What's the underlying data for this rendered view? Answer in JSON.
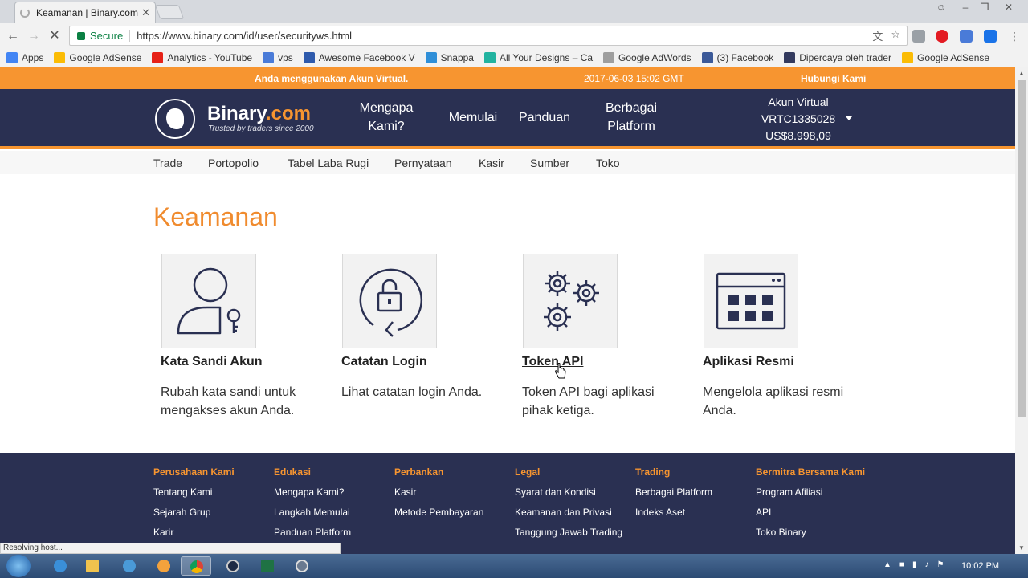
{
  "browser": {
    "tab_title": "Keamanan | Binary.com",
    "tab_close": "✕",
    "secure_label": "Secure",
    "url": "https://www.binary.com/id/user/securityws.html",
    "status_text": "Resolving host..."
  },
  "bookmarks": [
    {
      "label": "Apps",
      "color": "#4285f4"
    },
    {
      "label": "Google AdSense",
      "color": "#fbbc05"
    },
    {
      "label": "Analytics - YouTube",
      "color": "#e62117"
    },
    {
      "label": "vps",
      "color": "#4a7bd8"
    },
    {
      "label": "Awesome Facebook V",
      "color": "#2e5aac"
    },
    {
      "label": "Snappa",
      "color": "#2f8fd8"
    },
    {
      "label": "All Your Designs – Ca",
      "color": "#22b3a0"
    },
    {
      "label": "Google AdWords",
      "color": "#9e9e9e"
    },
    {
      "label": "(3) Facebook",
      "color": "#3b5998"
    },
    {
      "label": "Dipercaya oleh trader",
      "color": "#333a5e"
    },
    {
      "label": "Google AdSense",
      "color": "#fbbc05"
    }
  ],
  "topbar": {
    "virtual_notice": "Anda menggunakan Akun Virtual.",
    "datetime": "2017-06-03 15:02 GMT",
    "contact": "Hubungi Kami"
  },
  "mainnav": {
    "logo_name": "Binary",
    "logo_tld": ".com",
    "logo_tagline": "Trusted by traders since 2000",
    "why_line1": "Mengapa",
    "why_line2": "Kami?",
    "start": "Memulai",
    "guide": "Panduan",
    "platforms_line1": "Berbagai",
    "platforms_line2": "Platform",
    "account_label": "Akun Virtual",
    "account_id": "VRTC1335028",
    "account_balance": "US$8.998,09"
  },
  "subnav": [
    "Trade",
    "Portopolio",
    "Tabel Laba Rugi",
    "Pernyataan",
    "Kasir",
    "Sumber",
    "Toko"
  ],
  "page": {
    "heading": "Keamanan",
    "cards": [
      {
        "title": "Kata Sandi Akun",
        "desc": "Rubah kata sandi untuk mengakses akun Anda."
      },
      {
        "title": "Catatan Login",
        "desc": "Lihat catatan login Anda."
      },
      {
        "title": "Token API",
        "desc": "Token API bagi aplikasi pihak ketiga."
      },
      {
        "title": "Aplikasi Resmi",
        "desc": "Mengelola aplikasi resmi Anda."
      }
    ]
  },
  "footer": [
    {
      "heading": "Perusahaan Kami",
      "links": [
        "Tentang Kami",
        "Sejarah Grup",
        "Karir"
      ]
    },
    {
      "heading": "Edukasi",
      "links": [
        "Mengapa Kami?",
        "Langkah Memulai",
        "Panduan Platform"
      ]
    },
    {
      "heading": "Perbankan",
      "links": [
        "Kasir",
        "Metode Pembayaran"
      ]
    },
    {
      "heading": "Legal",
      "links": [
        "Syarat dan Kondisi",
        "Keamanan dan Privasi",
        "Tanggung Jawab Trading"
      ]
    },
    {
      "heading": "Trading",
      "links": [
        "Berbagai Platform",
        "Indeks Aset"
      ]
    },
    {
      "heading": "Bermitra Bersama Kami",
      "links": [
        "Program Afiliasi",
        "API",
        "Toko Binary"
      ]
    }
  ],
  "taskbar": {
    "clock": "10:02 PM"
  },
  "colors": {
    "brand_orange": "#f79530",
    "brand_navy": "#2a3052",
    "heading_orange": "#f08b2e"
  }
}
